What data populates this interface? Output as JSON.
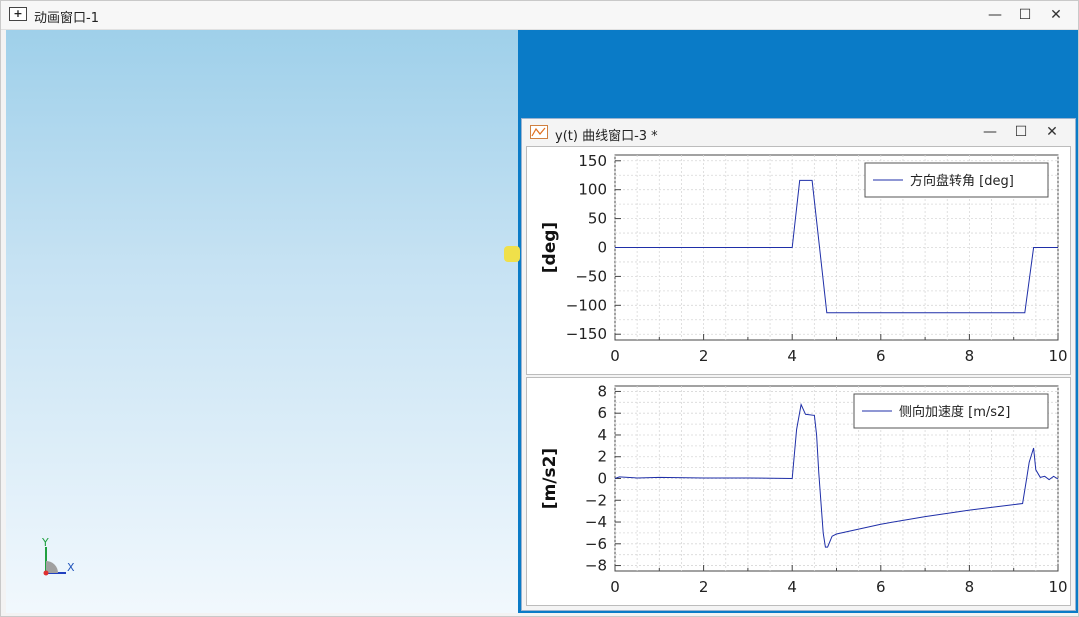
{
  "main_window": {
    "title": "动画窗口-1",
    "app_icon_glyph": "+",
    "minimize_glyph": "—",
    "maximize_glyph": "☐",
    "close_glyph": "✕"
  },
  "scene": {
    "y_axis_label": "Y",
    "x_axis_label": "X"
  },
  "curve_window": {
    "title": "y(t) 曲线窗口-3 *",
    "icon": "curve-chart-icon",
    "minimize_glyph": "—",
    "maximize_glyph": "☐",
    "close_glyph": "✕"
  },
  "colors": {
    "scene_top": "#9fd0ea",
    "scene_bottom": "#f1f8fd",
    "blue_panel": "#0a7bc7",
    "curve_line": "#1f2fa8",
    "grid": "#d8d8d8"
  },
  "chart_data": [
    {
      "type": "line",
      "ylabel": "[deg]",
      "xlabel": "",
      "xlim": [
        0,
        10
      ],
      "ylim": [
        -160,
        160
      ],
      "xticks": [
        0,
        2,
        4,
        6,
        8,
        10
      ],
      "yticks": [
        150,
        100,
        50,
        0,
        -50,
        -100,
        -150
      ],
      "ytick_labels": [
        "150",
        "100",
        "50",
        "0",
        "−50",
        "−100",
        "−150"
      ],
      "legend_position": "top-right",
      "series": [
        {
          "name": "方向盘转角 [deg]",
          "x": [
            0,
            4.0,
            4.17,
            4.45,
            4.78,
            9.25,
            9.45,
            10.0
          ],
          "y": [
            0,
            0,
            116,
            116,
            -113,
            -113,
            0,
            0
          ]
        }
      ]
    },
    {
      "type": "line",
      "ylabel": "[m/s2]",
      "xlabel": "",
      "xlim": [
        0,
        10
      ],
      "ylim": [
        -8.5,
        8.5
      ],
      "xticks": [
        0,
        2,
        4,
        6,
        8,
        10
      ],
      "yticks": [
        8,
        6,
        4,
        2,
        0,
        -2,
        -4,
        -6,
        -8
      ],
      "ytick_labels": [
        "8",
        "6",
        "4",
        "2",
        "0",
        "−2",
        "−4",
        "−6",
        "−8"
      ],
      "legend_position": "top-right",
      "series": [
        {
          "name": "侧向加速度 [m/s2]",
          "x": [
            0,
            0.1,
            0.5,
            1.0,
            2.0,
            3.0,
            4.0,
            4.1,
            4.2,
            4.3,
            4.5,
            4.55,
            4.6,
            4.7,
            4.75,
            4.8,
            4.9,
            5.0,
            6.0,
            7.0,
            8.0,
            9.0,
            9.2,
            9.3,
            9.35,
            9.45,
            9.5,
            9.6,
            9.7,
            9.8,
            9.9,
            10.0
          ],
          "y": [
            0,
            0.15,
            0.05,
            0.1,
            0.05,
            0.05,
            0.0,
            4.5,
            6.8,
            5.9,
            5.8,
            4.0,
            0.5,
            -5.0,
            -6.3,
            -6.3,
            -5.3,
            -5.1,
            -4.2,
            -3.5,
            -2.9,
            -2.4,
            -2.3,
            0.2,
            1.5,
            2.8,
            0.8,
            0.1,
            0.2,
            -0.1,
            0.2,
            -0.05
          ]
        }
      ]
    }
  ]
}
